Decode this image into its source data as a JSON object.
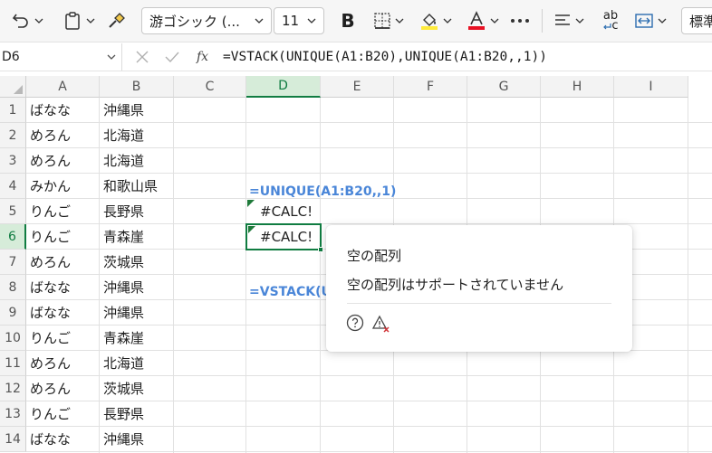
{
  "toolbar": {
    "font_name": "游ゴシック (...",
    "font_size": "11",
    "bold_label": "B",
    "abc_label": "ab",
    "abc_sub": "c",
    "number_format": "標準",
    "font_color": "#e81123",
    "fill_color": "#ffeb3b"
  },
  "formula_bar": {
    "name_box": "D6",
    "fx_label": "fx",
    "formula": "=VSTACK(UNIQUE(A1:B20),UNIQUE(A1:B20,,1))"
  },
  "sheet": {
    "columns": [
      "A",
      "B",
      "C",
      "D",
      "E",
      "F",
      "G",
      "H",
      "I"
    ],
    "rows": [
      "1",
      "2",
      "3",
      "4",
      "5",
      "6",
      "7",
      "8",
      "9",
      "10",
      "11",
      "12",
      "13",
      "14"
    ],
    "col_a": [
      "ばなな",
      "めろん",
      "めろん",
      "みかん",
      "りんご",
      "りんご",
      "めろん",
      "ばなな",
      "ばなな",
      "りんご",
      "めろん",
      "めろん",
      "りんご",
      "ばなな"
    ],
    "col_b": [
      "沖縄県",
      "北海道",
      "北海道",
      "和歌山県",
      "長野県",
      "青森崖",
      "茨城県",
      "沖縄県",
      "沖縄県",
      "青森崖",
      "北海道",
      "茨城県",
      "長野県",
      "沖縄県"
    ],
    "d1_formula_text": "=UNIQUE(A1:B20,,1)",
    "d2_value": "#CALC!",
    "d5_formula_text": "=VSTACK(UNIQUE(A1:B20),UNIQUE(A1:B20,,1))",
    "d6_value": "#CALC!",
    "selected_col": "D",
    "selected_row": "6"
  },
  "popup": {
    "title": "空の配列",
    "description": "空の配列はサポートされていません",
    "help_icon": "help-circle-icon",
    "error_icon": "warning-error-icon"
  },
  "colors": {
    "accent_green": "#107c41",
    "formula_text_blue": "#4a86d8"
  }
}
